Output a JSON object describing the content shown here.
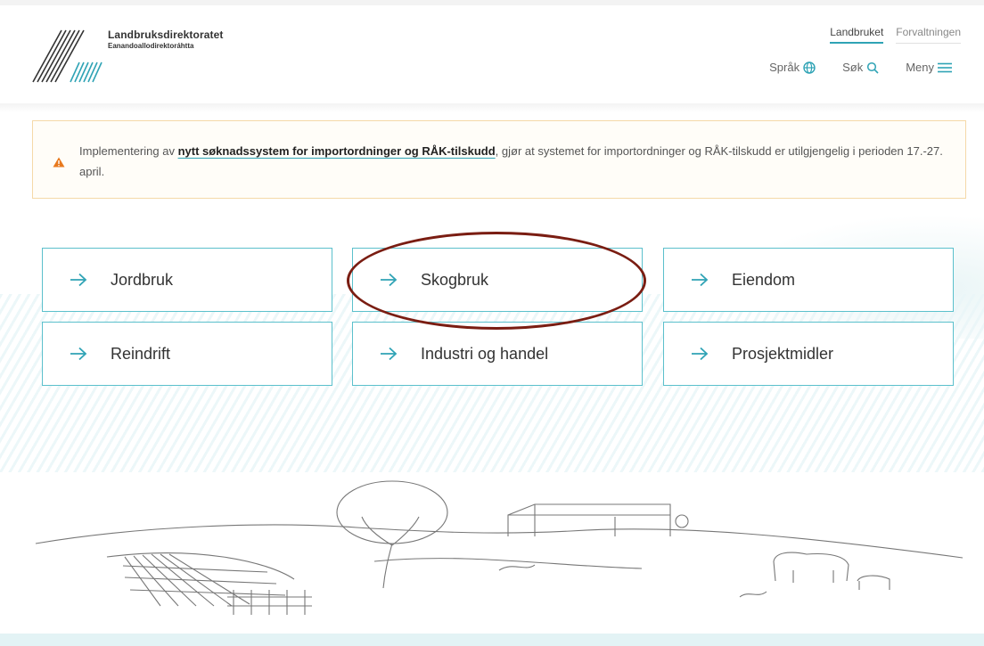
{
  "brand": {
    "name": "Landbruksdirektoratet",
    "subname": "Eanandoallodirektoráhtta"
  },
  "tabs": [
    {
      "label": "Landbruket",
      "active": true
    },
    {
      "label": "Forvaltningen",
      "active": false
    }
  ],
  "utilities": {
    "language_label": "Språk",
    "search_label": "Søk",
    "menu_label": "Meny"
  },
  "alert": {
    "text_before": "Implementering av ",
    "link_text": "nytt søknadssystem for importordninger og RÅK-tilskudd",
    "text_after": ", gjør at systemet for importordninger og RÅK-tilskudd er utilgjengelig i perioden 17.-27. april."
  },
  "categories": [
    {
      "label": "Jordbruk"
    },
    {
      "label": "Skogbruk"
    },
    {
      "label": "Eiendom"
    },
    {
      "label": "Reindrift"
    },
    {
      "label": "Industri og handel"
    },
    {
      "label": "Prosjektmidler"
    }
  ],
  "colors": {
    "accent": "#2fa3b5",
    "card_border": "#5bc0cc",
    "alert_border": "#f5d9a8",
    "warning_icon": "#e8791e",
    "highlight_circle": "#7a1d12"
  }
}
